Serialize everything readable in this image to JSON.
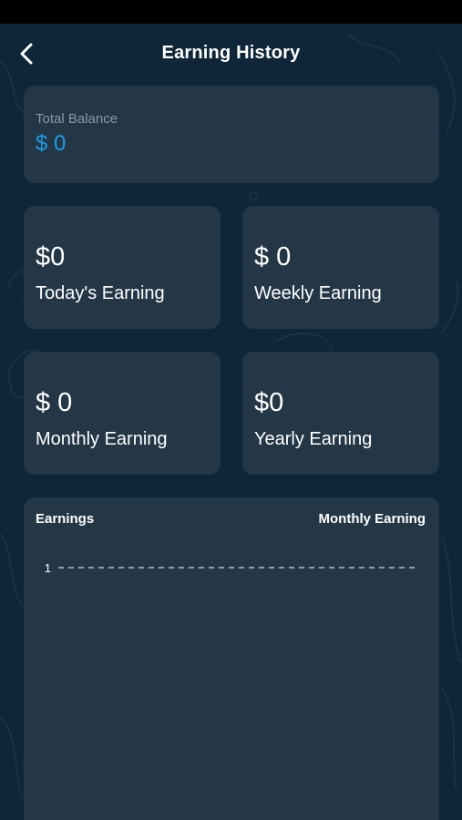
{
  "header": {
    "title": "Earning History",
    "back_icon": "chevron-left-icon"
  },
  "balance": {
    "label": "Total Balance",
    "value": "$ 0",
    "value_color": "#1f9be8"
  },
  "stats": [
    {
      "value": "$0",
      "label": "Today's Earning"
    },
    {
      "value": "$ 0",
      "label": "Weekly Earning"
    },
    {
      "value": "$ 0",
      "label": "Monthly Earning"
    },
    {
      "value": "$0",
      "label": "Yearly Earning"
    }
  ],
  "chart": {
    "title": "Earnings",
    "period": "Monthly Earning"
  },
  "chart_data": {
    "type": "line",
    "title": "Earnings",
    "xlabel": "",
    "ylabel": "",
    "y_ticks": [
      "1"
    ],
    "series": [],
    "grid": "dashed line at 1"
  },
  "colors": {
    "background": "#0f2638",
    "card": "#243746",
    "accent": "#1f9be8"
  }
}
